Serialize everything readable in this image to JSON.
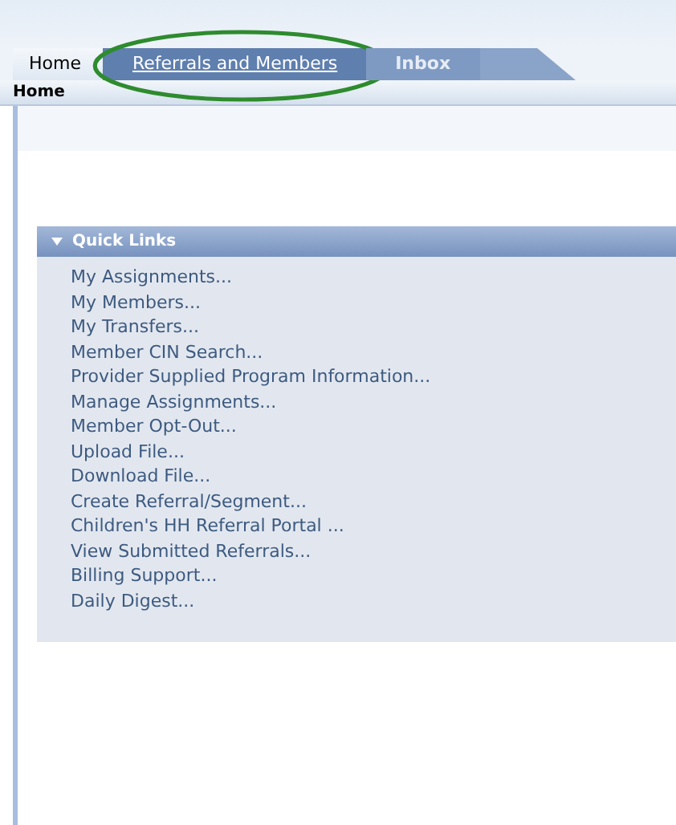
{
  "tabs": [
    {
      "label": "Home",
      "selected": true,
      "link": false,
      "circled": false
    },
    {
      "label": "Referrals and Members",
      "selected": false,
      "link": true,
      "circled": true
    },
    {
      "label": "Inbox",
      "selected": false,
      "link": false,
      "circled": false
    }
  ],
  "breadcrumb": "Home",
  "quick_links": {
    "title": "Quick Links",
    "expanded": true,
    "items": [
      "My Assignments...",
      "My Members...",
      "My Transfers...",
      "Member CIN Search...",
      "Provider Supplied Program Information...",
      "Manage Assignments...",
      "Member Opt-Out...",
      "Upload File...",
      "Download File...",
      "Create Referral/Segment...",
      "Children's HH Referral Portal ...",
      "View Submitted Referrals...",
      "Billing Support...",
      "Daily Digest..."
    ]
  }
}
